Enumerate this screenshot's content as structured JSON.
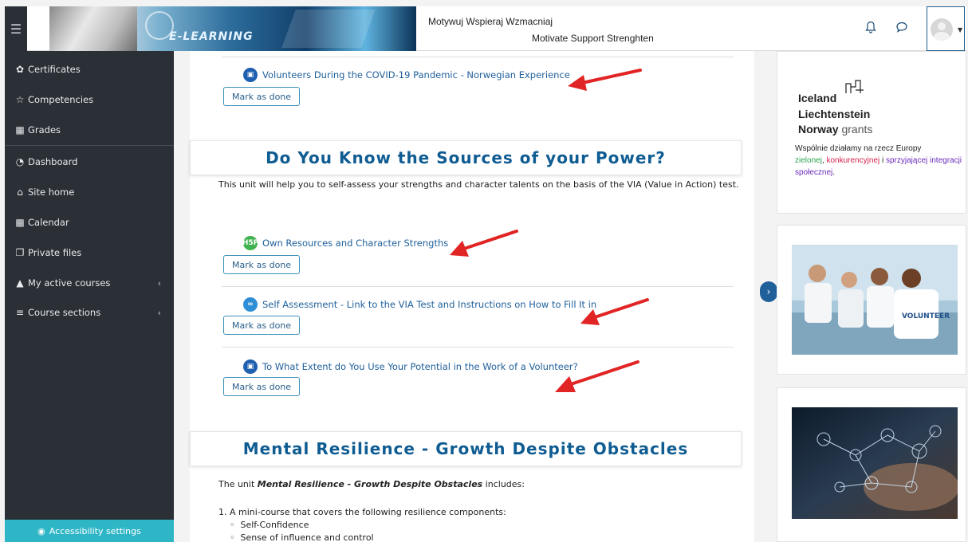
{
  "header": {
    "menu_icon": "hamburger-icon",
    "banner_text": "E-LEARNING",
    "title_line1": "Motywuj Wspieraj Wzmacniaj",
    "title_line2": "Motivate Support Strenghten",
    "icons": [
      "bell-icon",
      "chat-icon",
      "avatar"
    ]
  },
  "sidebar": {
    "items": [
      {
        "label": "Certificates",
        "icon": "certificate-icon"
      },
      {
        "label": "Competencies",
        "icon": "star-icon"
      },
      {
        "label": "Grades",
        "icon": "grades-icon"
      },
      {
        "label": "Dashboard",
        "icon": "dashboard-icon"
      },
      {
        "label": "Site home",
        "icon": "home-icon"
      },
      {
        "label": "Calendar",
        "icon": "calendar-icon"
      },
      {
        "label": "Private files",
        "icon": "files-icon"
      },
      {
        "label": "My active courses",
        "icon": "graduation-cap-icon"
      },
      {
        "label": "Course sections",
        "icon": "list-icon"
      }
    ],
    "accessibility": "Accessibility settings"
  },
  "main": {
    "activity_top": "Volunteers During the COVID-19 Pandemic - Norwegian Experience",
    "mark_done": "Mark as done",
    "section1_title": "Do You Know the Sources of your Power?",
    "section1_desc": "This unit will help you to self-assess your strengths and character talents on the basis of the VIA (Value in Action) test.",
    "activities": [
      {
        "label": "Own Resources and Character Strengths",
        "icon": "h5p-icon"
      },
      {
        "label": "Self Assessment - Link to the VIA Test and Instructions on How to Fill It in",
        "icon": "link-icon"
      },
      {
        "label": "To What Extent do You Use Your Potential in the Work of a Volunteer?",
        "icon": "page-icon"
      }
    ],
    "section2_title": "Mental Resilience - Growth Despite Obstacles",
    "section2_intro_pre": "The unit ",
    "section2_intro_em": "Mental Resilience - Growth Despite Obstacles",
    "section2_intro_post": " includes:",
    "section2_item1": "1. A mini-course that covers the following resilience components:",
    "section2_bullets": [
      "Self-Confidence",
      "Sense of influence and control"
    ]
  },
  "right": {
    "eea_line1": "Iceland",
    "eea_line2": "Liechtenstein",
    "eea_line3": "Norway",
    "eea_grants": "grants",
    "desc_pre": "Wspólnie działamy na rzecz Europy",
    "desc_green": "zielonej",
    "desc_sep1": ", ",
    "desc_red": "konkurencyjnej",
    "desc_sep2": " i ",
    "desc_purple": "sprzyjającej integracji społecznej",
    "desc_end": ".",
    "photo1_shirt_text": "VOLUNTEER"
  }
}
